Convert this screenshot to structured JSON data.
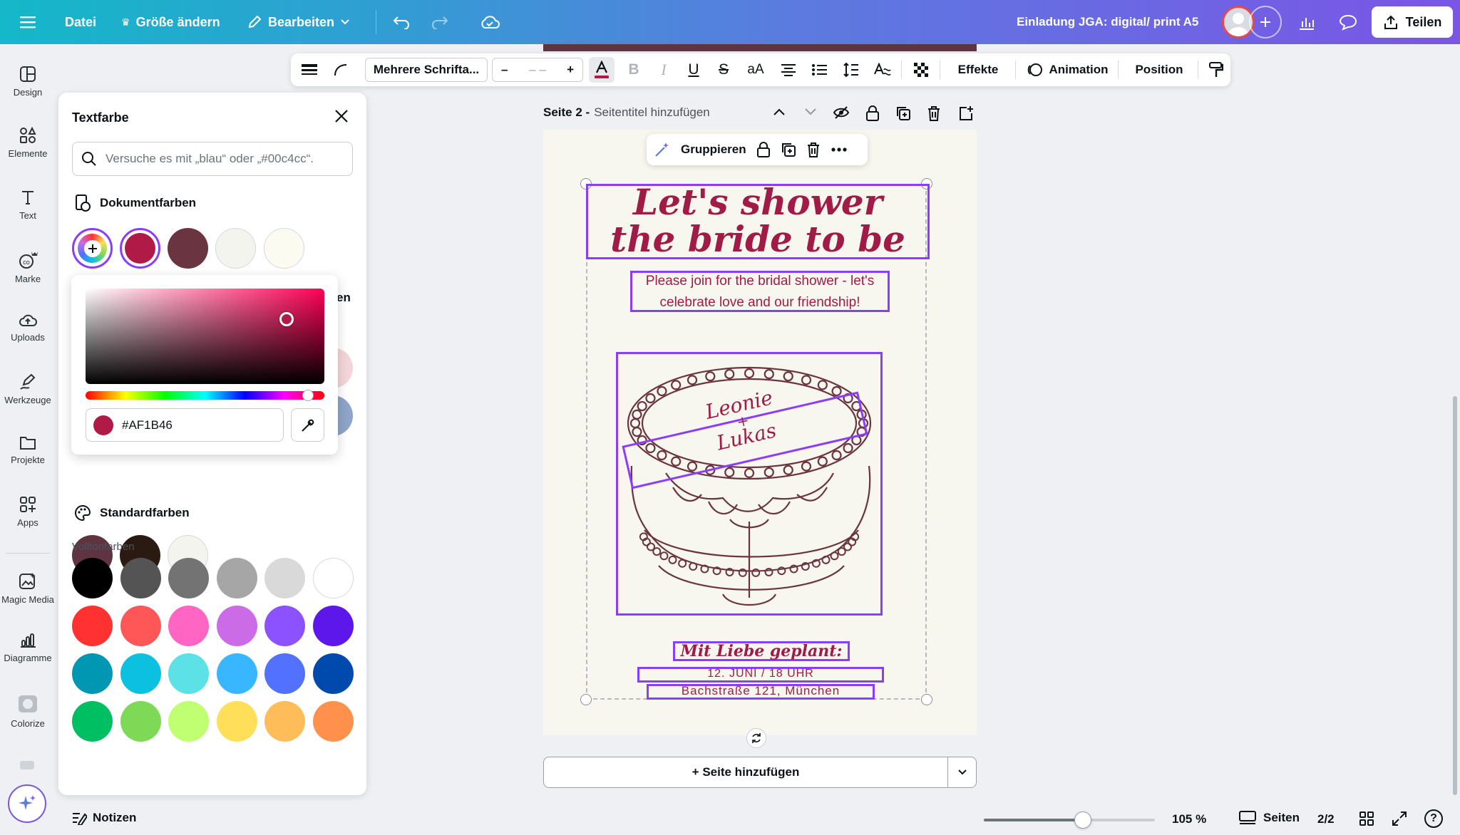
{
  "topbar": {
    "file_label": "Datei",
    "resize_label": "Größe ändern",
    "edit_label": "Bearbeiten",
    "doc_title": "Einladung JGA: digital/ print A5",
    "share_label": "Teilen"
  },
  "rail": {
    "items": [
      {
        "label": "Design",
        "icon": "layout-icon"
      },
      {
        "label": "Elemente",
        "icon": "shapes-icon"
      },
      {
        "label": "Text",
        "icon": "text-icon"
      },
      {
        "label": "Marke",
        "icon": "brand-icon"
      },
      {
        "label": "Uploads",
        "icon": "cloud-upload-icon"
      },
      {
        "label": "Werkzeuge",
        "icon": "pen-icon"
      },
      {
        "label": "Projekte",
        "icon": "folder-icon"
      },
      {
        "label": "Apps",
        "icon": "apps-icon"
      },
      {
        "label": "Magic Media",
        "icon": "magic-media-icon"
      },
      {
        "label": "Diagramme",
        "icon": "chart-icon"
      },
      {
        "label": "Colorize",
        "icon": "colorize-icon"
      }
    ]
  },
  "color_panel": {
    "title": "Textfarbe",
    "search_placeholder": "Versuche es mit „blau“ oder „#00c4cc“.",
    "doc_colors_title": "Dokumentfarben",
    "doc_colors": [
      "#af1b46",
      "#6a3440",
      "#f4f4ee",
      "#fcfbf2"
    ],
    "hidden_row_colors": [
      "#5e3440",
      "#2a1a12",
      "#f4f4ee"
    ],
    "partial_section_fragment": "en",
    "standard_title": "Standardfarben",
    "solid_label": "Volltonfarben",
    "solid_colors": [
      "#000000",
      "#545454",
      "#737373",
      "#a6a6a6",
      "#d9d9d9",
      "#ffffff",
      "#ff3131",
      "#ff5757",
      "#ff66c4",
      "#cb6ce6",
      "#8c52ff",
      "#5e17eb",
      "#0097b2",
      "#0cc0df",
      "#5ce1e6",
      "#38b6ff",
      "#5271ff",
      "#004aad",
      "#00bf63",
      "#7ed957",
      "#c1ff72",
      "#ffde59",
      "#ffbd59",
      "#ff914d"
    ],
    "picker_hex": "#AF1B46",
    "picker_hue_fraction": 0.93
  },
  "format_toolbar": {
    "font_name": "Mehrere Schrifta...",
    "size_placeholder": "– –",
    "minus": "–",
    "plus": "+",
    "effects": "Effekte",
    "animation": "Animation",
    "position": "Position"
  },
  "page": {
    "page_label": "Seite 2 -",
    "page_title_placeholder": "Seitentitel hinzufügen",
    "group_label": "Gruppieren",
    "headline_line1": "Let's shower",
    "headline_line2": "the bride to be",
    "intro_line1": "Please join for the bridal shower - let's",
    "intro_line2": "celebrate love and our friendship!",
    "cake_name1": "Leonie",
    "cake_plus": "+",
    "cake_name2": "Lukas",
    "planned_label": "Mit Liebe geplant:",
    "date_text": "12. JUNI / 18 UHR",
    "address_text": "Bachstraße 121, München",
    "add_page": "+ Seite hinzufügen"
  },
  "bottombar": {
    "notes": "Notizen",
    "zoom": "105 %",
    "zoom_fraction": 0.58,
    "pages_label": "Seiten",
    "page_count": "2/2"
  },
  "accent": "#8b3dff",
  "brand_text_color": "#af1b46"
}
